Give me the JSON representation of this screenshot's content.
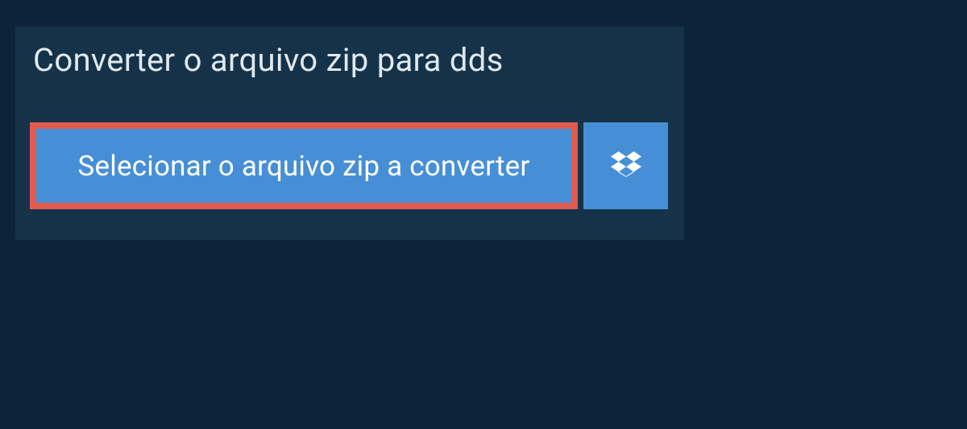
{
  "title": "Converter o arquivo zip para dds",
  "selectButton": {
    "label": "Selecionar o arquivo zip a converter"
  },
  "dropboxButton": {
    "iconName": "dropbox-icon"
  }
}
